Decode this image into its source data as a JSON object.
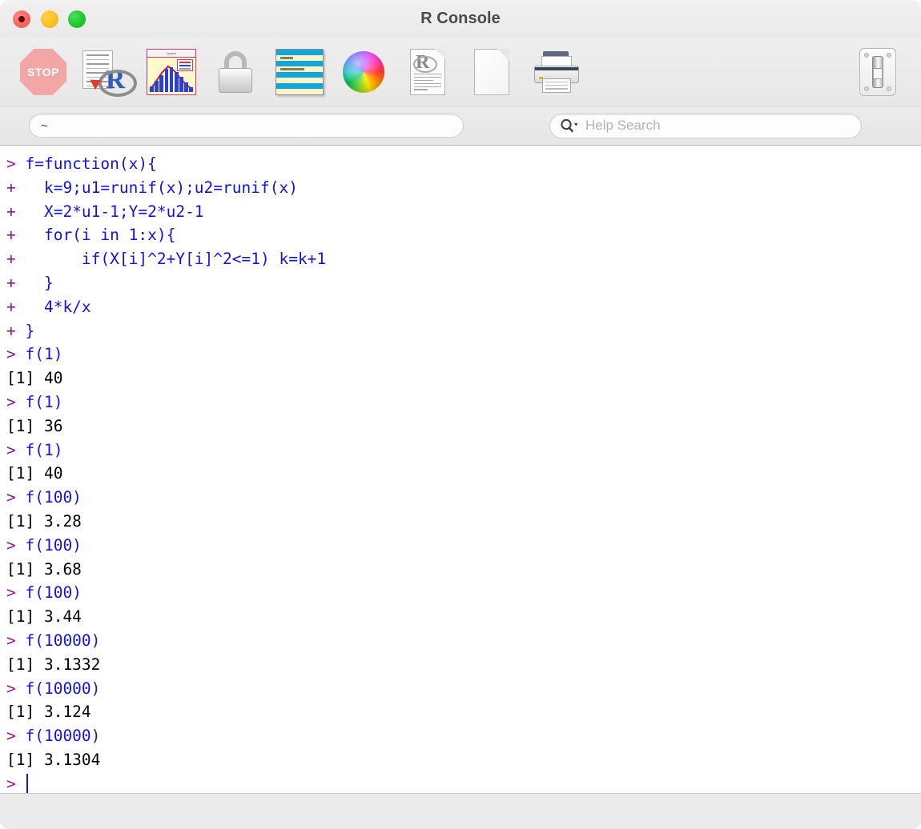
{
  "window": {
    "title": "R Console",
    "traffic_lights": [
      {
        "name": "close",
        "color": "#fb6560"
      },
      {
        "name": "minimize",
        "color": "#fdc023"
      },
      {
        "name": "zoom",
        "color": "#1ec92c"
      }
    ]
  },
  "toolbar": {
    "items": [
      {
        "name": "stop-button",
        "icon": "stop-icon",
        "label": "STOP"
      },
      {
        "name": "source-file-button",
        "icon": "r-source-document-icon",
        "label": ""
      },
      {
        "name": "quartz-plot-button",
        "icon": "quartz-plot-window-icon",
        "label": "Quartz"
      },
      {
        "name": "lock-button",
        "icon": "padlock-icon",
        "label": ""
      },
      {
        "name": "data-editor-button",
        "icon": "striped-list-icon",
        "label": ""
      },
      {
        "name": "color-picker-button",
        "icon": "color-wheel-icon",
        "label": ""
      },
      {
        "name": "r-help-document-button",
        "icon": "r-document-icon",
        "label": ""
      },
      {
        "name": "new-document-button",
        "icon": "blank-page-icon",
        "label": ""
      },
      {
        "name": "print-button",
        "icon": "printer-icon",
        "label": ""
      },
      {
        "name": "customize-toolbar-button",
        "icon": "toggle-switch-icon",
        "label": ""
      }
    ]
  },
  "search_row": {
    "working_directory": "~",
    "help_search_placeholder": "Help Search",
    "help_search_value": ""
  },
  "console": {
    "clipped_top_line": "- -",
    "lines": [
      {
        "prompt": ">",
        "code": "f=function(x){",
        "output": null
      },
      {
        "prompt": "+",
        "code": "  k=9;u1=runif(x);u2=runif(x)",
        "output": null
      },
      {
        "prompt": "+",
        "code": "  X=2*u1-1;Y=2*u2-1",
        "output": null
      },
      {
        "prompt": "+",
        "code": "  for(i in 1:x){",
        "output": null
      },
      {
        "prompt": "+",
        "code": "      if(X[i]^2+Y[i]^2<=1) k=k+1",
        "output": null
      },
      {
        "prompt": "+",
        "code": "  }",
        "output": null
      },
      {
        "prompt": "+",
        "code": "  4*k/x",
        "output": null
      },
      {
        "prompt": "+",
        "code": "}",
        "output": null
      },
      {
        "prompt": ">",
        "code": "f(1)",
        "output": null
      },
      {
        "prompt": null,
        "code": null,
        "output": "[1] 40"
      },
      {
        "prompt": ">",
        "code": "f(1)",
        "output": null
      },
      {
        "prompt": null,
        "code": null,
        "output": "[1] 36"
      },
      {
        "prompt": ">",
        "code": "f(1)",
        "output": null
      },
      {
        "prompt": null,
        "code": null,
        "output": "[1] 40"
      },
      {
        "prompt": ">",
        "code": "f(100)",
        "output": null
      },
      {
        "prompt": null,
        "code": null,
        "output": "[1] 3.28"
      },
      {
        "prompt": ">",
        "code": "f(100)",
        "output": null
      },
      {
        "prompt": null,
        "code": null,
        "output": "[1] 3.68"
      },
      {
        "prompt": ">",
        "code": "f(100)",
        "output": null
      },
      {
        "prompt": null,
        "code": null,
        "output": "[1] 3.44"
      },
      {
        "prompt": ">",
        "code": "f(10000)",
        "output": null
      },
      {
        "prompt": null,
        "code": null,
        "output": "[1] 3.1332"
      },
      {
        "prompt": ">",
        "code": "f(10000)",
        "output": null
      },
      {
        "prompt": null,
        "code": null,
        "output": "[1] 3.124"
      },
      {
        "prompt": ">",
        "code": "f(10000)",
        "output": null
      },
      {
        "prompt": null,
        "code": null,
        "output": "[1] 3.1304"
      }
    ],
    "active_prompt": ">",
    "active_input": ""
  },
  "colors": {
    "prompt": "#8b1a8b",
    "code": "#1414d8",
    "output": "#000000",
    "console_background": "#ffffff",
    "chrome_background": "#ececec"
  },
  "statusbar": {
    "text": ""
  }
}
